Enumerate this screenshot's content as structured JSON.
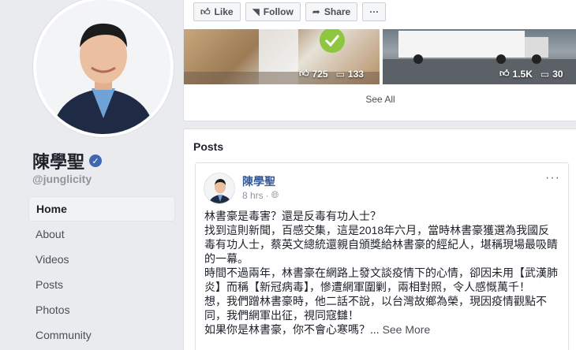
{
  "profile": {
    "name": "陳學聖",
    "handle": "@junglicity"
  },
  "nav": {
    "items": [
      {
        "label": "Home",
        "active": true
      },
      {
        "label": "About"
      },
      {
        "label": "Videos"
      },
      {
        "label": "Posts"
      },
      {
        "label": "Photos"
      },
      {
        "label": "Community"
      }
    ]
  },
  "videos": {
    "actions": {
      "like": "Like",
      "follow": "Follow",
      "share": "Share",
      "more": "···"
    },
    "items": [
      {
        "reactions": "725",
        "comments": "133"
      },
      {
        "reactions": "1.5K",
        "comments": "30"
      }
    ],
    "see_all": "See All"
  },
  "posts": {
    "title": "Posts",
    "post": {
      "author": "陳學聖",
      "time": "8 hrs",
      "privacy_icon": "globe-icon",
      "menu": "···",
      "lines": [
        "林書豪是毒害？還是反毒有功人士？",
        "找到這則新聞，百感交集，這是2018年六月，當時林書豪獲選為我國反",
        "毒有功人士，蔡英文總統還親自頒獎給林書豪的經紀人，堪稱現場最吸睛",
        "的一幕。",
        "時間不過兩年，林書豪在網路上發文談疫情下的心情，卻因未用【武漢肺",
        "炎】而稱【新冠病毒】，慘遭網軍圍剿，兩相對照，令人感慨萬千！",
        "想，我們蹭林書豪時，他二話不說，以台灣故鄉為榮，現因疫情觀點不",
        "同，我們網軍出征，視同寇讎！",
        "如果你是林書豪，你不會心寒嗎？..."
      ],
      "see_more": "See More"
    }
  },
  "colors": {
    "link": "#365899",
    "brand": "#4267b2",
    "background": "#e9ebee"
  }
}
